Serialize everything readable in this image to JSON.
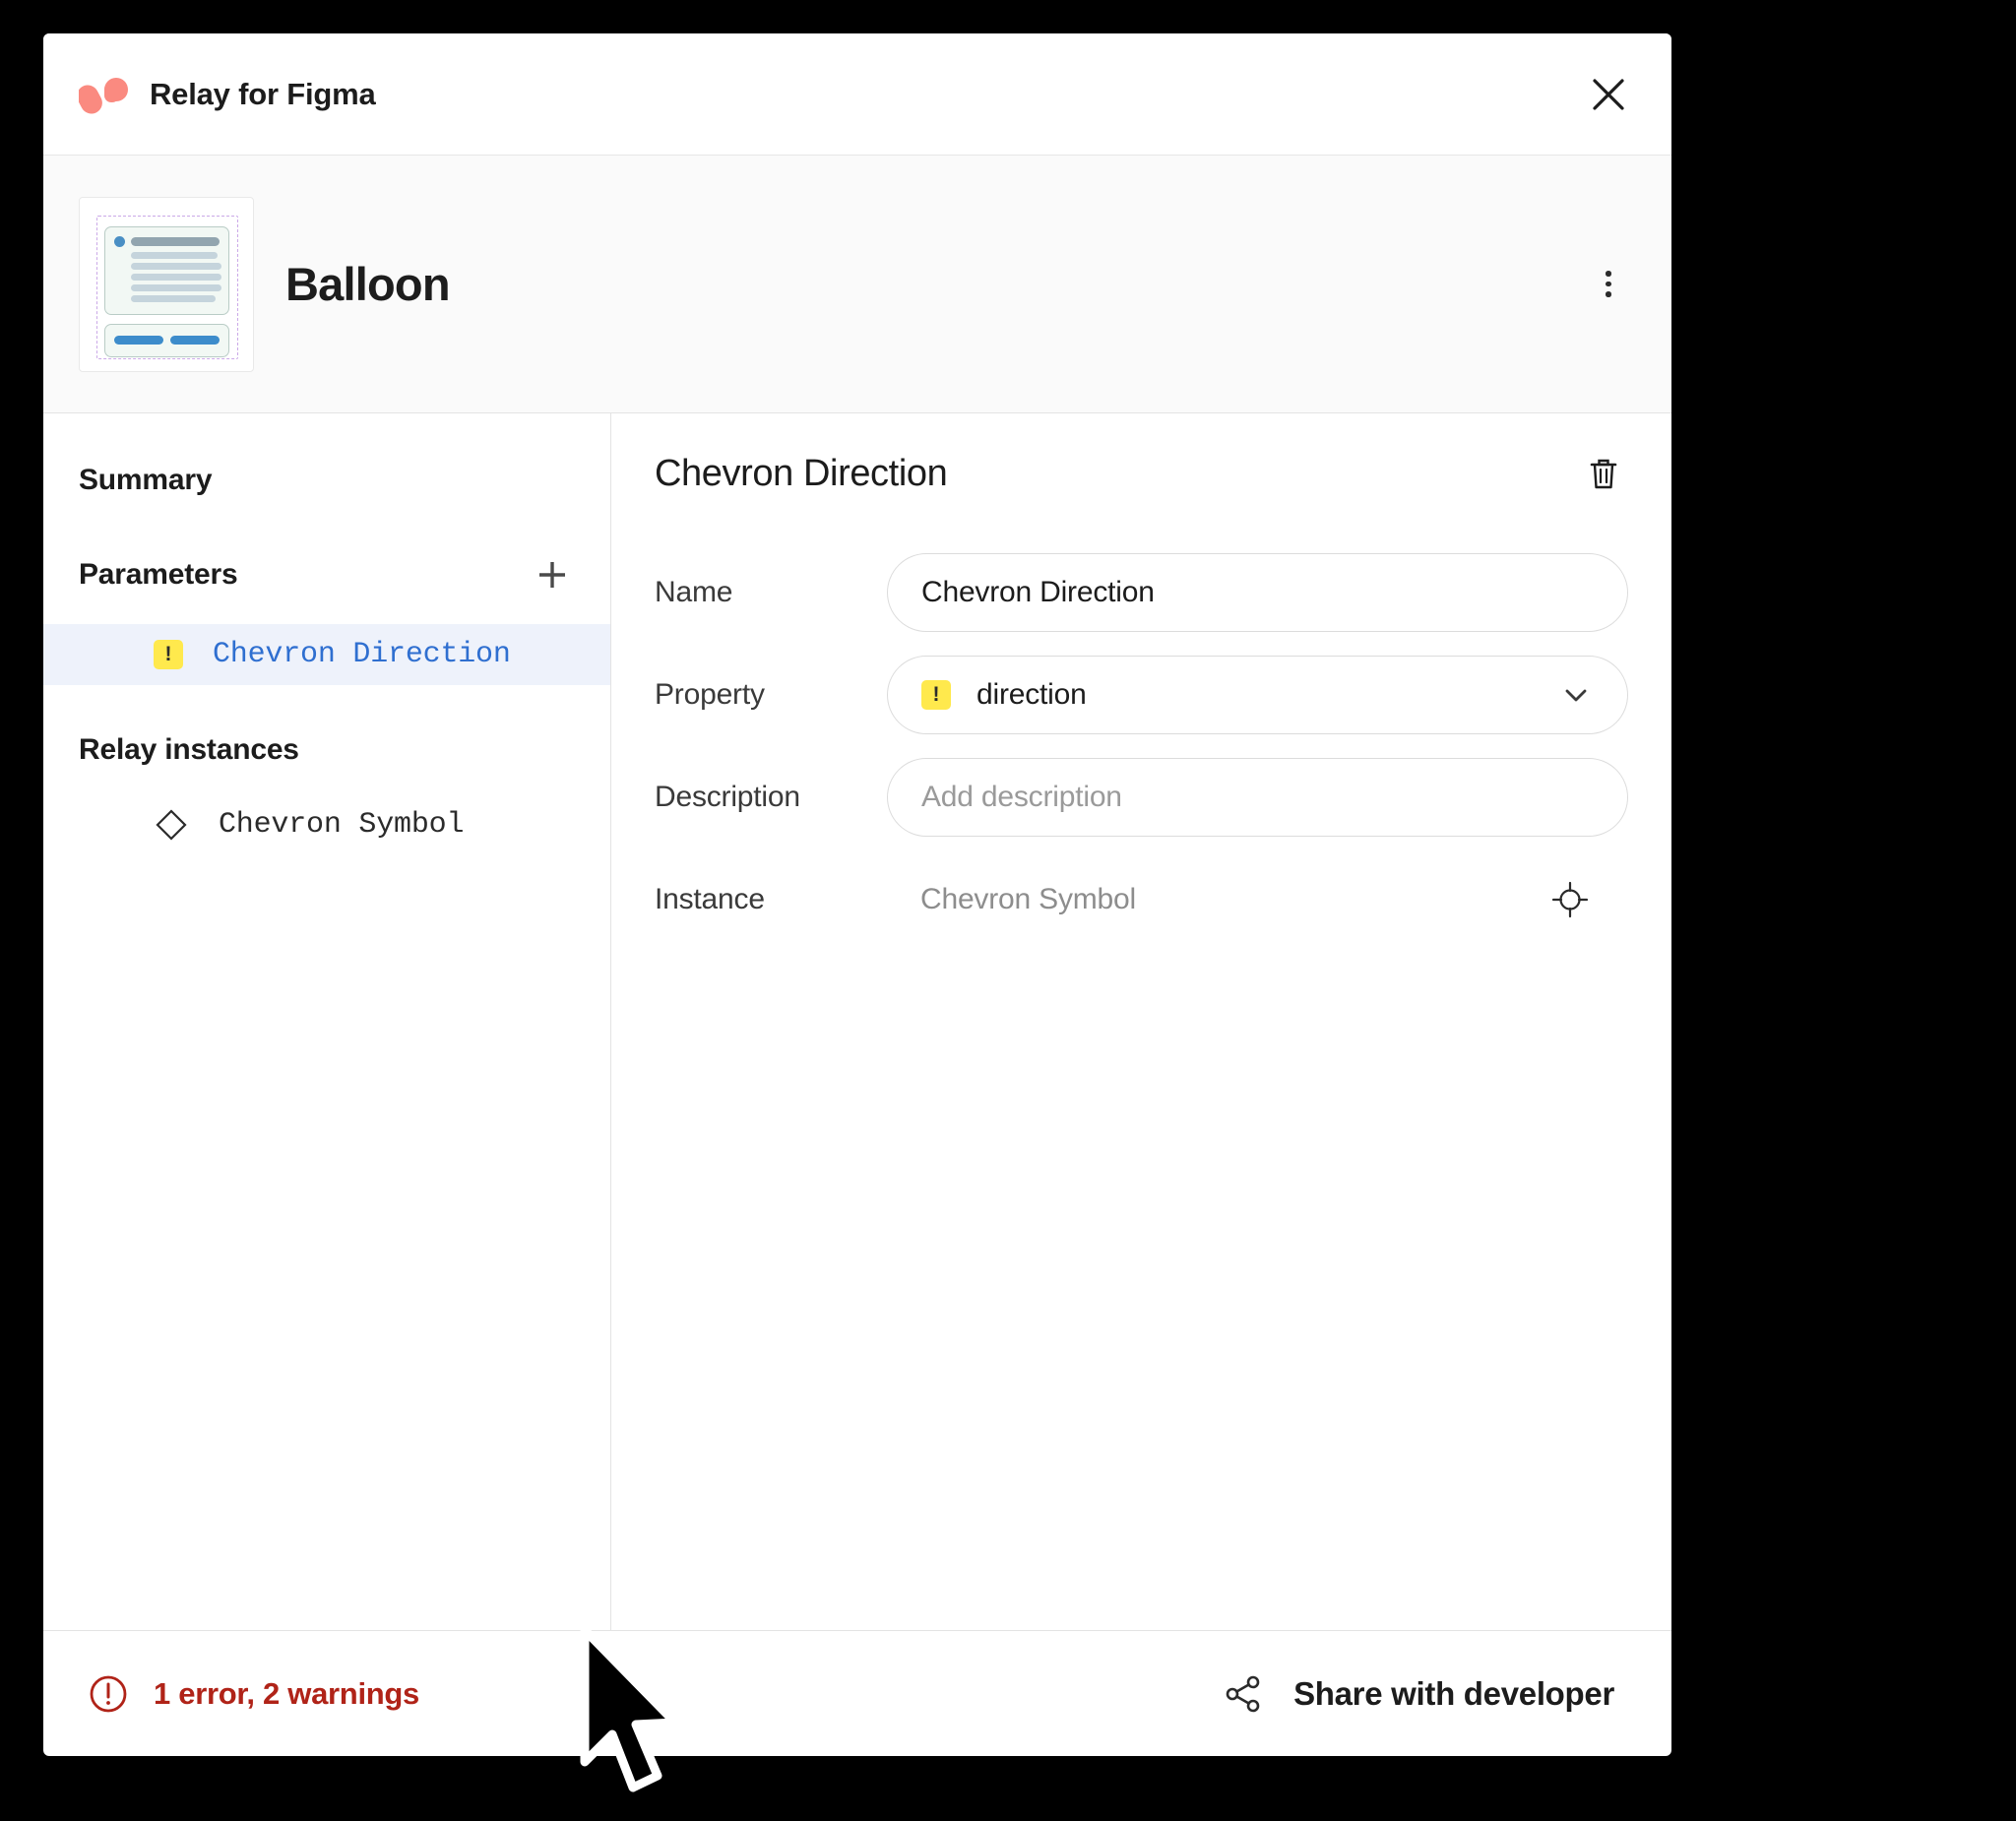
{
  "titlebar": {
    "app_name": "Relay for Figma",
    "logo_color": "#fa8a80",
    "close_label": "✕"
  },
  "component_header": {
    "name": "Balloon",
    "menu_label": "More options"
  },
  "sidebar": {
    "summary_label": "Summary",
    "parameters_label": "Parameters",
    "add_parameter_label": "+",
    "parameters": [
      {
        "badge": "!",
        "label": "Chevron Direction",
        "selected": true
      }
    ],
    "relay_instances_label": "Relay instances",
    "instances": [
      {
        "icon": "diamond-icon",
        "label": "Chevron Symbol"
      }
    ]
  },
  "detail": {
    "title": "Chevron Direction",
    "delete_label": "Delete parameter",
    "fields": {
      "name_label": "Name",
      "name_value": "Chevron Direction",
      "property_label": "Property",
      "property_badge": "!",
      "property_value": "direction",
      "description_label": "Description",
      "description_value": "",
      "description_placeholder": "Add description",
      "instance_label": "Instance",
      "instance_value": "Chevron Symbol",
      "instance_locate_label": "Locate instance"
    }
  },
  "footer": {
    "status_text": "1 error, 2 warnings",
    "status_color": "#b02318",
    "share_text": "Share with developer"
  },
  "colors": {
    "accent_blue": "#2f6fd0",
    "warning_yellow": "#ffe94d",
    "selected_row": "#eef2fb",
    "brand": "#fa8a80"
  }
}
